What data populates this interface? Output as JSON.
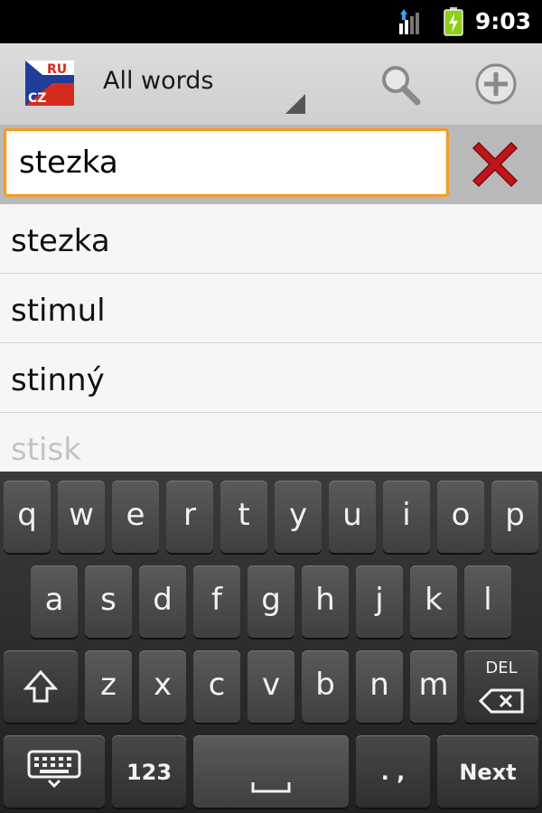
{
  "status_bar": {
    "time": "9:03"
  },
  "action_bar": {
    "logo_text_top": "RU",
    "logo_text_bottom": "CZ",
    "spinner_label": "All words"
  },
  "search": {
    "value": "stezka"
  },
  "word_list": {
    "items": [
      "stezka",
      "stimul",
      "stinný",
      "stisk"
    ]
  },
  "keyboard": {
    "row1": [
      "q",
      "w",
      "e",
      "r",
      "t",
      "y",
      "u",
      "i",
      "o",
      "p"
    ],
    "row2": [
      "a",
      "s",
      "d",
      "f",
      "g",
      "h",
      "j",
      "k",
      "l"
    ],
    "row3": [
      "z",
      "x",
      "c",
      "v",
      "b",
      "n",
      "m"
    ],
    "del_label": "DEL",
    "num_label": "123",
    "punct_label": ". ,",
    "next_label": "Next"
  },
  "colors": {
    "search_focus_border": "#f19c26",
    "clear_icon": "#c0141a",
    "flag_blue": "#1f3d99",
    "flag_red": "#d52b1e"
  }
}
